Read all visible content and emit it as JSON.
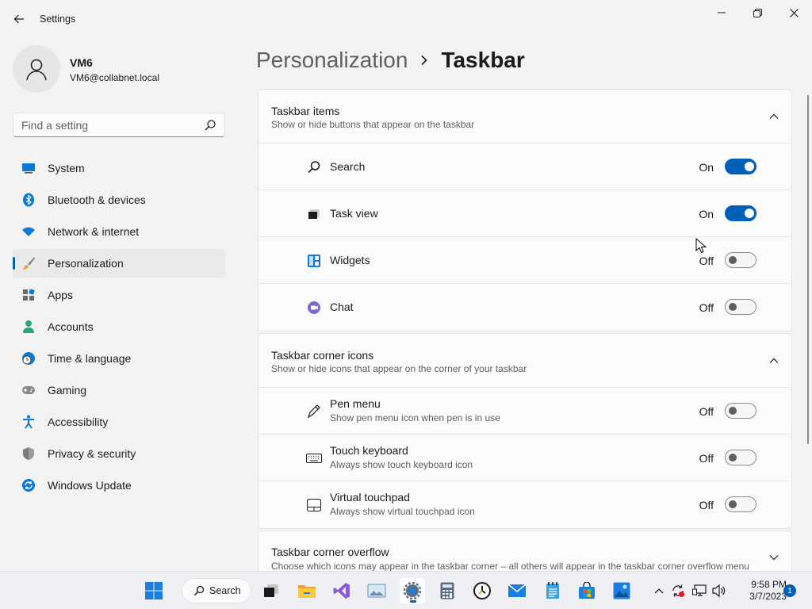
{
  "window": {
    "title": "Settings"
  },
  "profile": {
    "name": "VM6",
    "email": "VM6@collabnet.local"
  },
  "search": {
    "placeholder": "Find a setting"
  },
  "nav": {
    "items": [
      {
        "label": "System",
        "icon": "monitor-icon"
      },
      {
        "label": "Bluetooth & devices",
        "icon": "bluetooth-icon"
      },
      {
        "label": "Network & internet",
        "icon": "wifi-icon"
      },
      {
        "label": "Personalization",
        "icon": "brush-icon",
        "selected": true
      },
      {
        "label": "Apps",
        "icon": "apps-icon"
      },
      {
        "label": "Accounts",
        "icon": "person-icon"
      },
      {
        "label": "Time & language",
        "icon": "clock-globe-icon"
      },
      {
        "label": "Gaming",
        "icon": "controller-icon"
      },
      {
        "label": "Accessibility",
        "icon": "accessibility-icon"
      },
      {
        "label": "Privacy & security",
        "icon": "shield-icon"
      },
      {
        "label": "Windows Update",
        "icon": "update-icon"
      }
    ]
  },
  "breadcrumb": {
    "parent": "Personalization",
    "current": "Taskbar"
  },
  "sections": {
    "taskbar_items": {
      "title": "Taskbar items",
      "subtitle": "Show or hide buttons that appear on the taskbar",
      "rows": [
        {
          "label": "Search",
          "state": "On",
          "on": true
        },
        {
          "label": "Task view",
          "state": "On",
          "on": true
        },
        {
          "label": "Widgets",
          "state": "Off",
          "on": false
        },
        {
          "label": "Chat",
          "state": "Off",
          "on": false
        }
      ]
    },
    "corner_icons": {
      "title": "Taskbar corner icons",
      "subtitle": "Show or hide icons that appear on the corner of your taskbar",
      "rows": [
        {
          "label": "Pen menu",
          "sub": "Show pen menu icon when pen is in use",
          "state": "Off",
          "on": false
        },
        {
          "label": "Touch keyboard",
          "sub": "Always show touch keyboard icon",
          "state": "Off",
          "on": false
        },
        {
          "label": "Virtual touchpad",
          "sub": "Always show virtual touchpad icon",
          "state": "Off",
          "on": false
        }
      ]
    },
    "corner_overflow": {
      "title": "Taskbar corner overflow",
      "subtitle": "Choose which icons may appear in the taskbar corner – all others will appear in the taskbar corner overflow menu"
    }
  },
  "taskbar": {
    "search_label": "Search",
    "time": "9:58 PM",
    "date": "3/7/2023",
    "notification_count": "1"
  },
  "colors": {
    "accent": "#005fb8",
    "background": "#f3f3f3",
    "card": "#fbfbfb"
  }
}
